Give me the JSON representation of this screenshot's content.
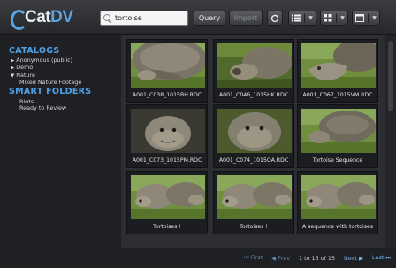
{
  "app": {
    "logo_prefix": "Cat",
    "logo_suffix": "DV"
  },
  "toolbar": {
    "search_value": "tortoise",
    "query_label": "Query",
    "import_label": "Import",
    "icons": [
      "refresh-icon",
      "list-view-icon",
      "grid-view-icon",
      "panel-icon"
    ]
  },
  "sidebar": {
    "catalogs_title": "CATALOGS",
    "catalogs": [
      {
        "label": "Anonymous (public)",
        "state": "collapsed"
      },
      {
        "label": "Demo",
        "state": "collapsed"
      },
      {
        "label": "Nature",
        "state": "expanded"
      }
    ],
    "nature_children": [
      "Mixed Nature Footage"
    ],
    "smart_folders_title": "SMART FOLDERS",
    "smart_folders": [
      "Birds",
      "Ready to Review"
    ]
  },
  "clips": [
    {
      "caption": "A001_C038_1015BH.RDC",
      "scene": "shell"
    },
    {
      "caption": "A001_C046_1015HK.RDC",
      "scene": "grass"
    },
    {
      "caption": "A001_C067_1015VM.RDC",
      "scene": "head"
    },
    {
      "caption": "A001_C073_1015PM.RDC",
      "scene": "face"
    },
    {
      "caption": "A001_C074_1015OA.RDC",
      "scene": "face2"
    },
    {
      "caption": "Tortoise Sequence",
      "scene": "shellgrass"
    },
    {
      "caption": "Tortoises !",
      "scene": "pair"
    },
    {
      "caption": "Tortoises !",
      "scene": "pair"
    },
    {
      "caption": "A sequence with tortoises",
      "scene": "pair"
    }
  ],
  "pager": {
    "first": "First",
    "prev": "Prev",
    "info": "1 to 15 of 15",
    "next": "Next",
    "last": "Last"
  },
  "colors": {
    "accent": "#4fa1e8",
    "background": "#2a2b2e"
  }
}
